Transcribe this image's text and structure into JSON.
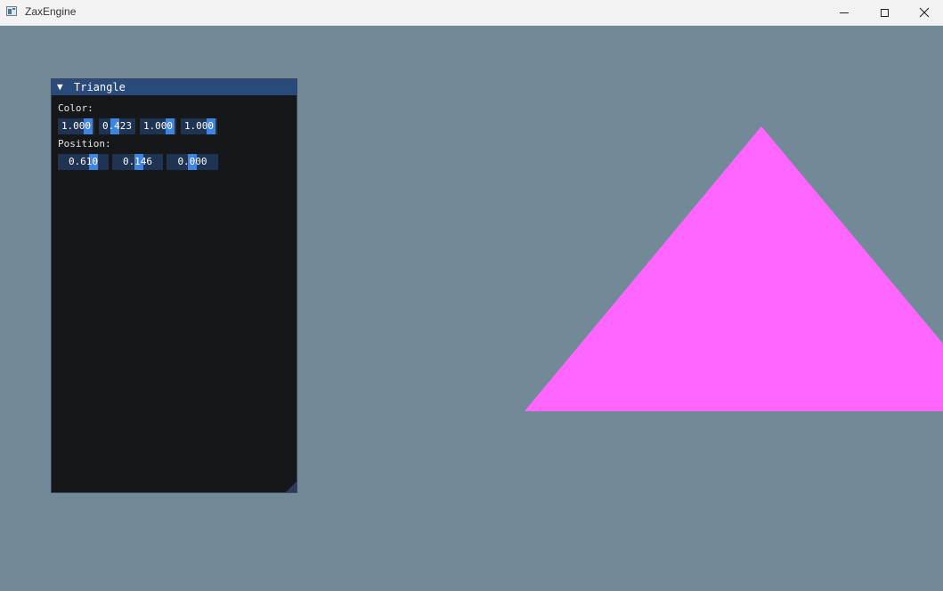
{
  "window": {
    "title": "ZaxEngine"
  },
  "panel": {
    "title": "Triangle",
    "color_label": "Color:",
    "position_label": "Position:",
    "color_values": [
      "1.000",
      "0.423",
      "1.000",
      "1.000"
    ],
    "position_values": [
      "0.610",
      "0.146",
      "0.000"
    ]
  },
  "scene": {
    "background_color": "#728a97",
    "triangle_color": "#ff66ff"
  },
  "theme": {
    "panel_bg": "#15171a",
    "header_bg": "#294a7a",
    "frame_bg": "#1f3352",
    "slider_grab": "#3d85e0"
  }
}
